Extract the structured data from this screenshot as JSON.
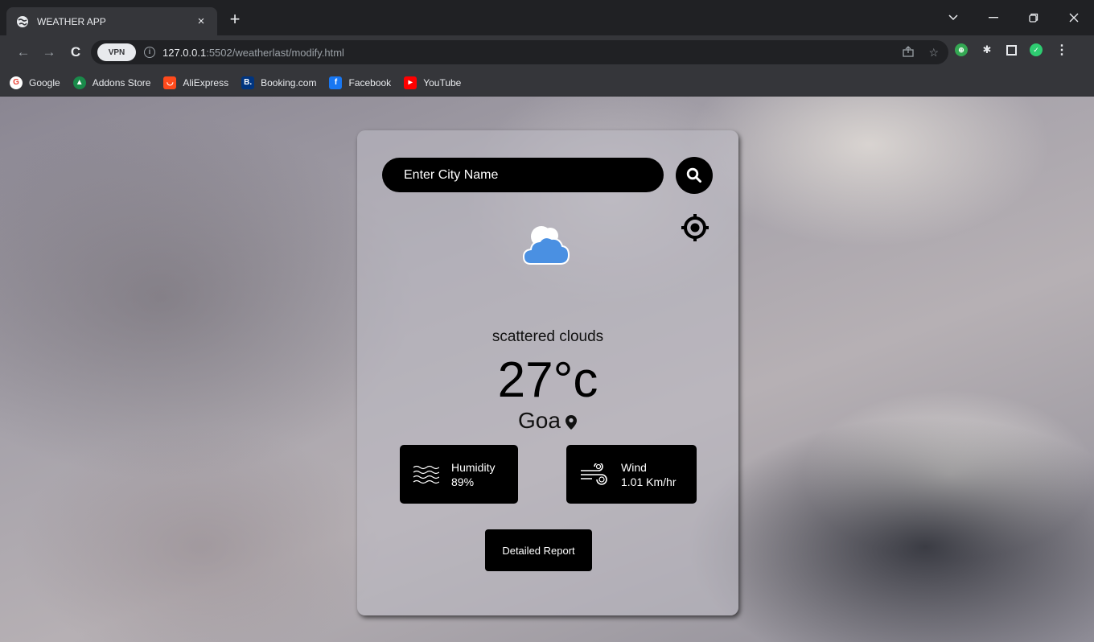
{
  "browser": {
    "tab_title": "WEATHER APP",
    "tab_close": "×",
    "new_tab": "+",
    "url_host": "127.0.0.1",
    "url_rest": ":5502/weatherlast/modify.html",
    "vpn_label": "VPN",
    "bookmarks": [
      {
        "label": "Google",
        "icon": "google-icon",
        "color": "#ea4335"
      },
      {
        "label": "Addons Store",
        "icon": "addons-store-icon",
        "color": "#1a8a4a"
      },
      {
        "label": "AliExpress",
        "icon": "aliexpress-icon",
        "color": "#ff4a1c"
      },
      {
        "label": "Booking.com",
        "icon": "booking-icon",
        "color": "#003580"
      },
      {
        "label": "Facebook",
        "icon": "facebook-icon",
        "color": "#1877f2"
      },
      {
        "label": "YouTube",
        "icon": "youtube-icon",
        "color": "#ff0000"
      }
    ]
  },
  "app": {
    "search": {
      "placeholder": "Enter City Name",
      "value": ""
    },
    "description": "scattered clouds",
    "temperature": "27°c",
    "city": "Goa",
    "humidity": {
      "label": "Humidity",
      "value": "89%"
    },
    "wind": {
      "label": "Wind",
      "value": "1.01 Km/hr"
    },
    "report_button": "Detailed Report",
    "colors": {
      "accent": "#000000",
      "cloud": "#4a90e2",
      "card": "#bebcc4"
    }
  }
}
